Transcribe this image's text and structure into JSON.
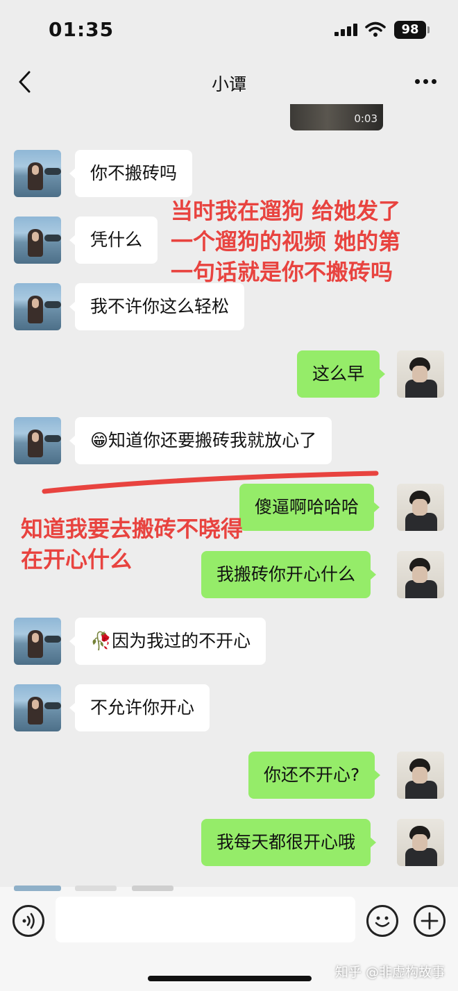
{
  "status_bar": {
    "time": "01:35",
    "battery": "98"
  },
  "header": {
    "title": "小谭"
  },
  "video": {
    "duration": "0:03"
  },
  "messages": [
    {
      "side": "left",
      "text": "你不搬砖吗"
    },
    {
      "side": "left",
      "text": "凭什么"
    },
    {
      "side": "left",
      "text": "我不许你这么轻松"
    },
    {
      "side": "right",
      "text": "这么早"
    },
    {
      "side": "left",
      "text": "😁知道你还要搬砖我就放心了"
    },
    {
      "side": "right",
      "text": "傻逼啊哈哈哈"
    },
    {
      "side": "right",
      "text": "我搬砖你开心什么"
    },
    {
      "side": "left",
      "text": "🥀因为我过的不开心"
    },
    {
      "side": "left",
      "text": "不允许你开心"
    },
    {
      "side": "right",
      "text": "你还不开心?"
    },
    {
      "side": "right",
      "text": "我每天都很开心哦"
    }
  ],
  "annotations": {
    "top": [
      "当时我在遛狗 给她发了",
      "一个遛狗的视频 她的第",
      "一句话就是你不搬砖吗"
    ],
    "middle": [
      "知道我要去搬砖不晓得",
      "在开心什么"
    ]
  },
  "watermark": "知乎 @非虚构故事",
  "colors": {
    "background": "#ededed",
    "bubble_right": "#95ec69",
    "bubble_left": "#ffffff",
    "annotation": "#e8433f"
  },
  "icons": [
    "back-chevron-icon",
    "more-dots-icon",
    "voice-icon",
    "emoji-icon",
    "plus-icon"
  ]
}
